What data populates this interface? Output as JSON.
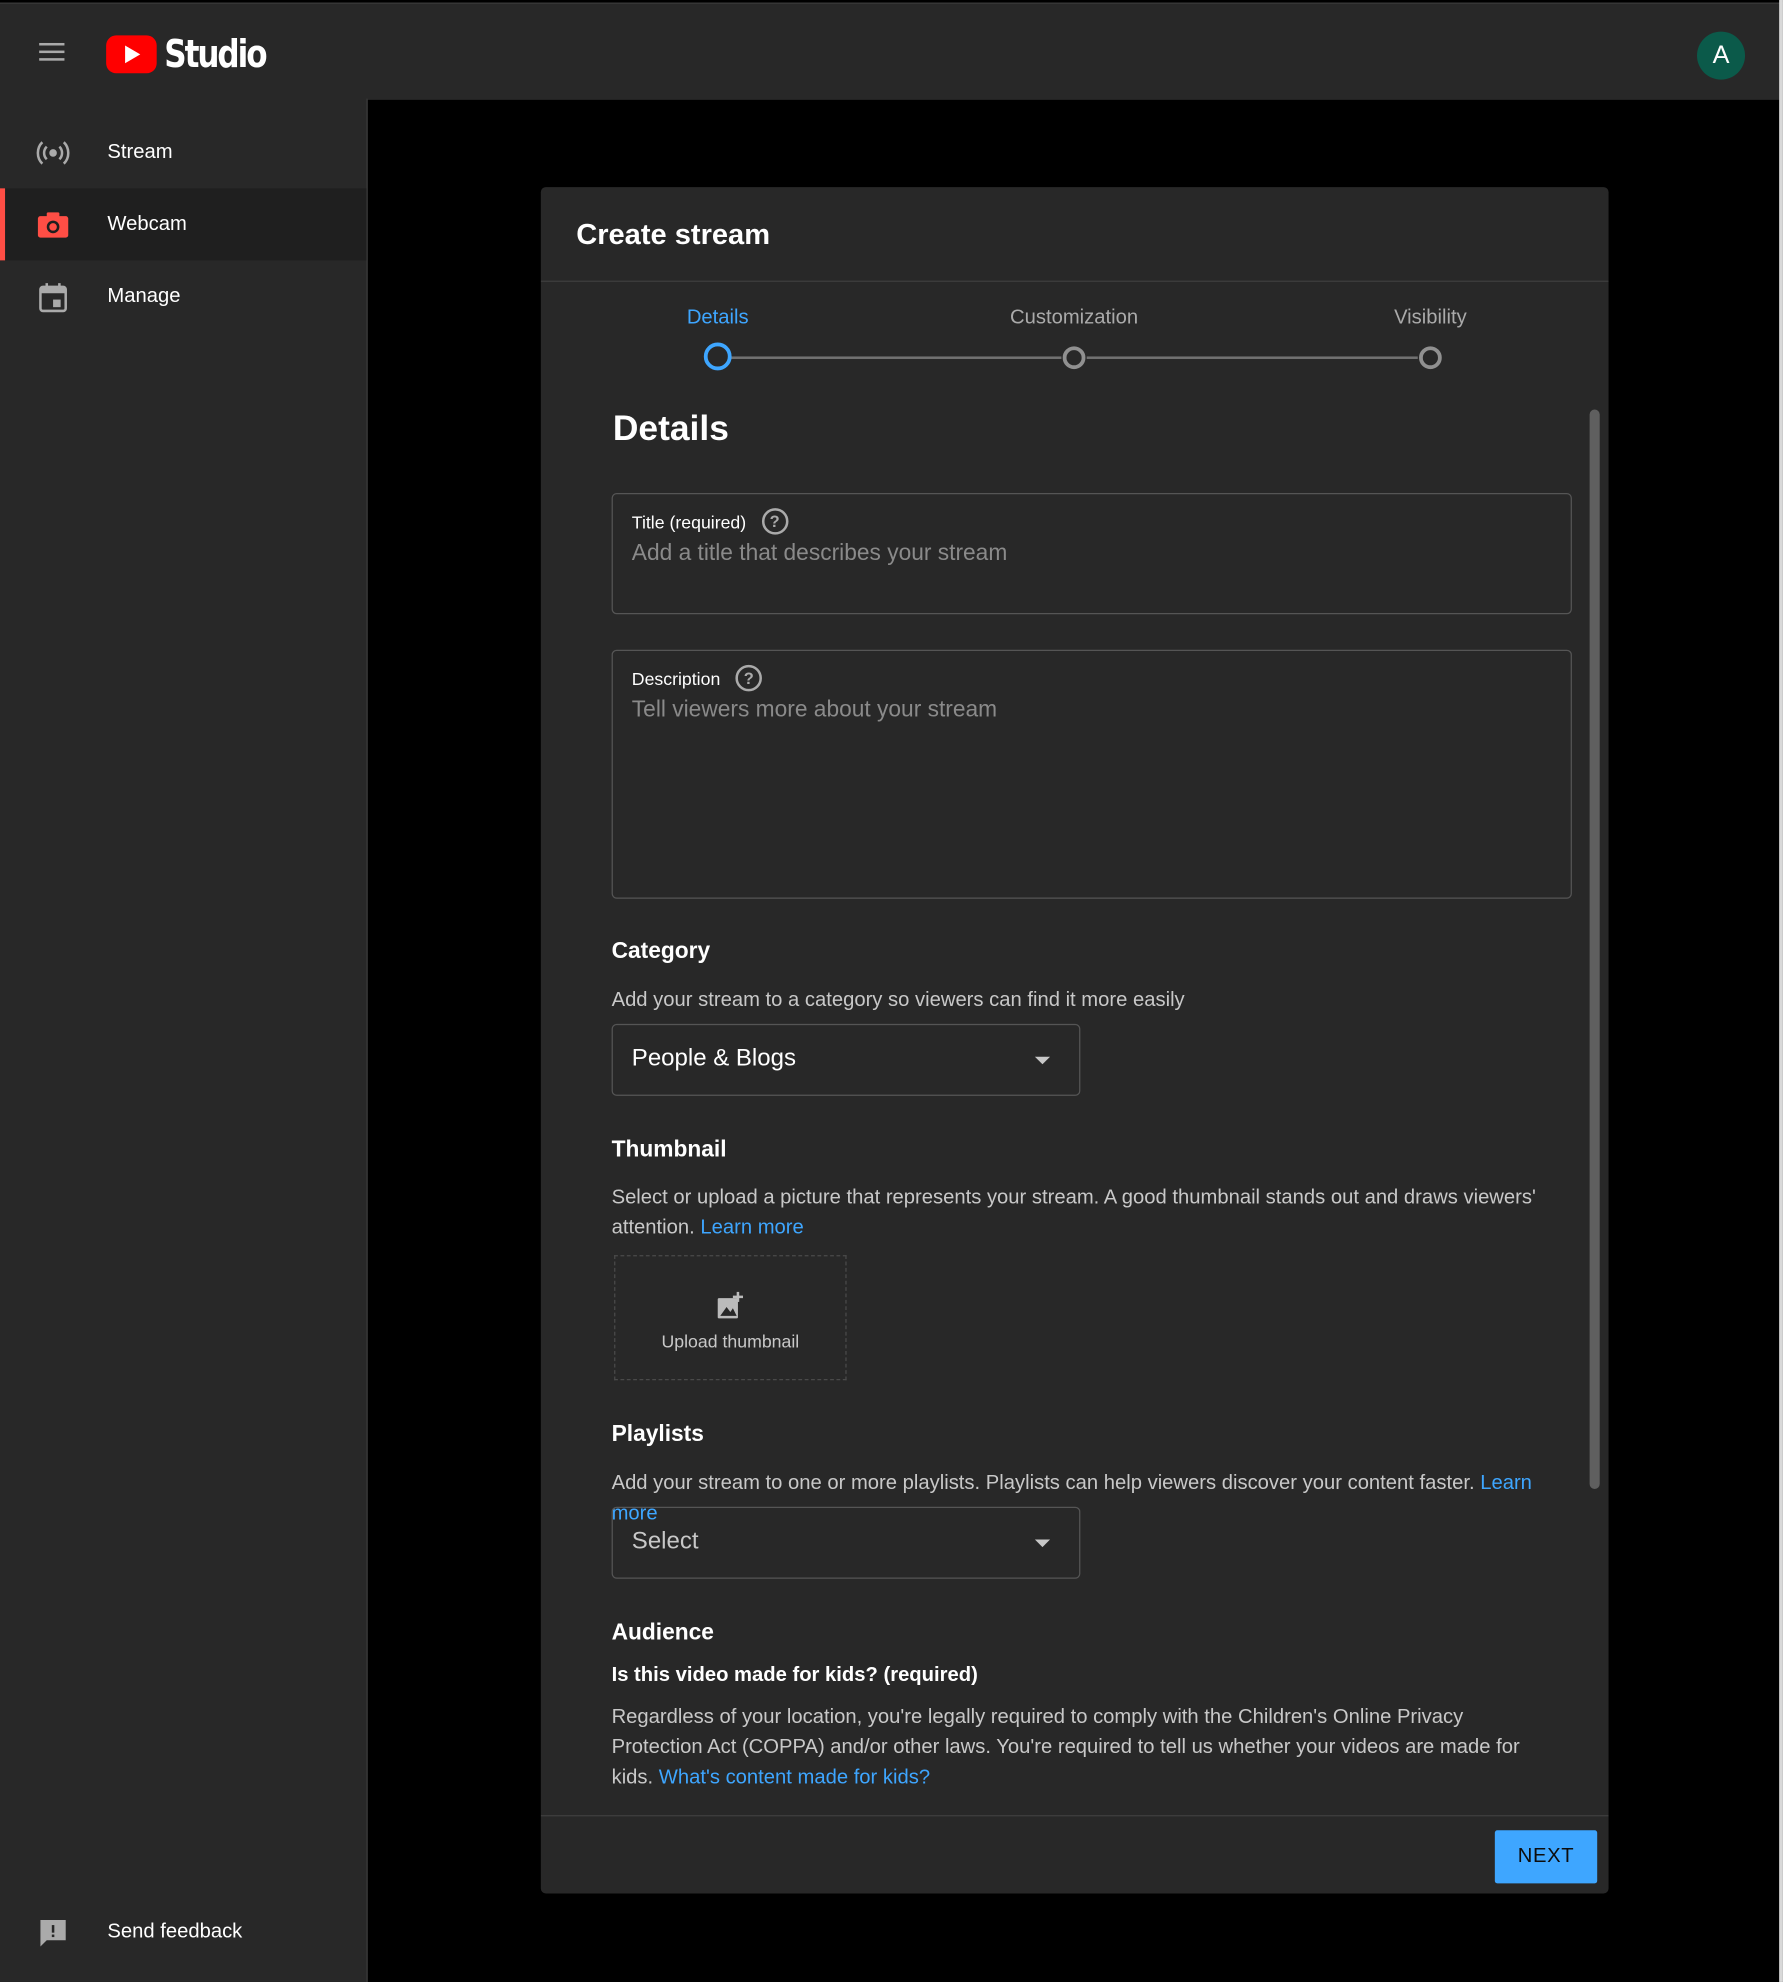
{
  "app": {
    "logo_text": "Studio",
    "avatar_letter": "A",
    "accent": "#3ea6ff",
    "brand": "#ff0000"
  },
  "sidebar": {
    "items": [
      {
        "label": "Stream",
        "icon": "stream-icon",
        "active": false
      },
      {
        "label": "Webcam",
        "icon": "camera-icon",
        "active": true
      },
      {
        "label": "Manage",
        "icon": "calendar-icon",
        "active": false
      }
    ],
    "feedback_label": "Send feedback"
  },
  "dialog": {
    "title": "Create stream",
    "steps": [
      {
        "label": "Details",
        "active": true
      },
      {
        "label": "Customization",
        "active": false
      },
      {
        "label": "Visibility",
        "active": false
      }
    ],
    "section_title": "Details",
    "title_field": {
      "label": "Title (required)",
      "placeholder": "Add a title that describes your stream"
    },
    "description_field": {
      "label": "Description",
      "placeholder": "Tell viewers more about your stream"
    },
    "category": {
      "heading": "Category",
      "text": "Add your stream to a category so viewers can find it more easily",
      "value": "People & Blogs"
    },
    "thumbnail": {
      "heading": "Thumbnail",
      "text": "Select or upload a picture that represents your stream. A good thumbnail stands out and draws viewers' attention.",
      "link": "Learn more",
      "upload_label": "Upload thumbnail"
    },
    "playlists": {
      "heading": "Playlists",
      "text": "Add your stream to one or more playlists. Playlists can help viewers discover your content faster.",
      "link": "Learn more",
      "value": "Select"
    },
    "audience": {
      "heading": "Audience",
      "question": "Is this video made for kids? (required)",
      "text": "Regardless of your location, you're legally required to comply with the Children's Online Privacy Protection Act (COPPA) and/or other laws. You're required to tell us whether your videos are made for kids.",
      "link": "What's content made for kids?"
    },
    "next_label": "NEXT"
  }
}
